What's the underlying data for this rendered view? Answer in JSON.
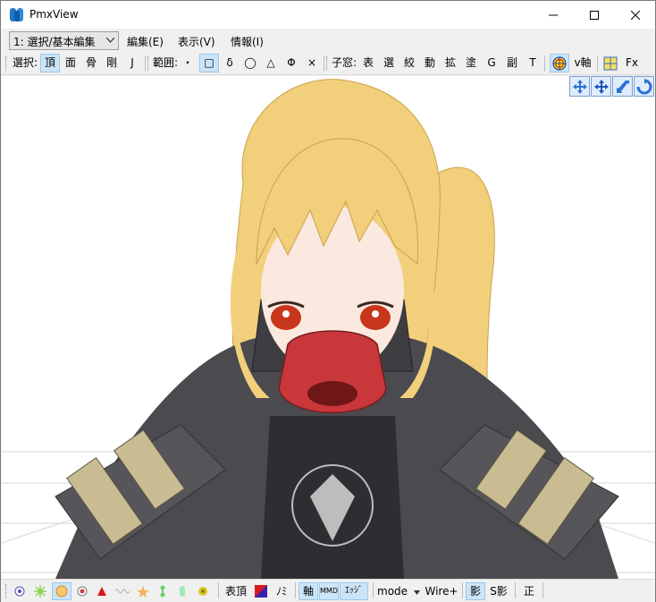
{
  "window": {
    "title": "PmxView"
  },
  "menu": {
    "mode_value": "1: 選択/基本編集",
    "items": [
      "編集(E)",
      "表示(V)",
      "情報(I)"
    ]
  },
  "toolbar": {
    "select_label": "選択:",
    "select_items": [
      "頂",
      "面",
      "骨",
      "剛",
      "J"
    ],
    "range_label": "範囲:",
    "range_items": [
      "・",
      "□",
      "δ",
      "◯",
      "△",
      "Φ",
      "×"
    ],
    "child_label": "子窓:",
    "child_items": [
      "表",
      "選",
      "絞",
      "動",
      "拡",
      "塗",
      "G",
      "副",
      "T"
    ],
    "v_axis_label": "v軸",
    "fx_label": "Fx"
  },
  "bottom_toolbar": {
    "vertex_label": "表頂",
    "no_label": "ﾉﾐ",
    "axis_label": "軸",
    "mmd_label": "MMD",
    "edge_label": "ｴｯｼﾞ",
    "mode_label": "mode",
    "wire_label": "Wire+",
    "shadow_label": "影",
    "sshadow_label": "S影",
    "sei_label": "正"
  },
  "colors": {
    "accent": "#0078d7",
    "hair": "#f2cf7a",
    "jacket": "#4a4a4f",
    "mask": "#c8373a"
  }
}
